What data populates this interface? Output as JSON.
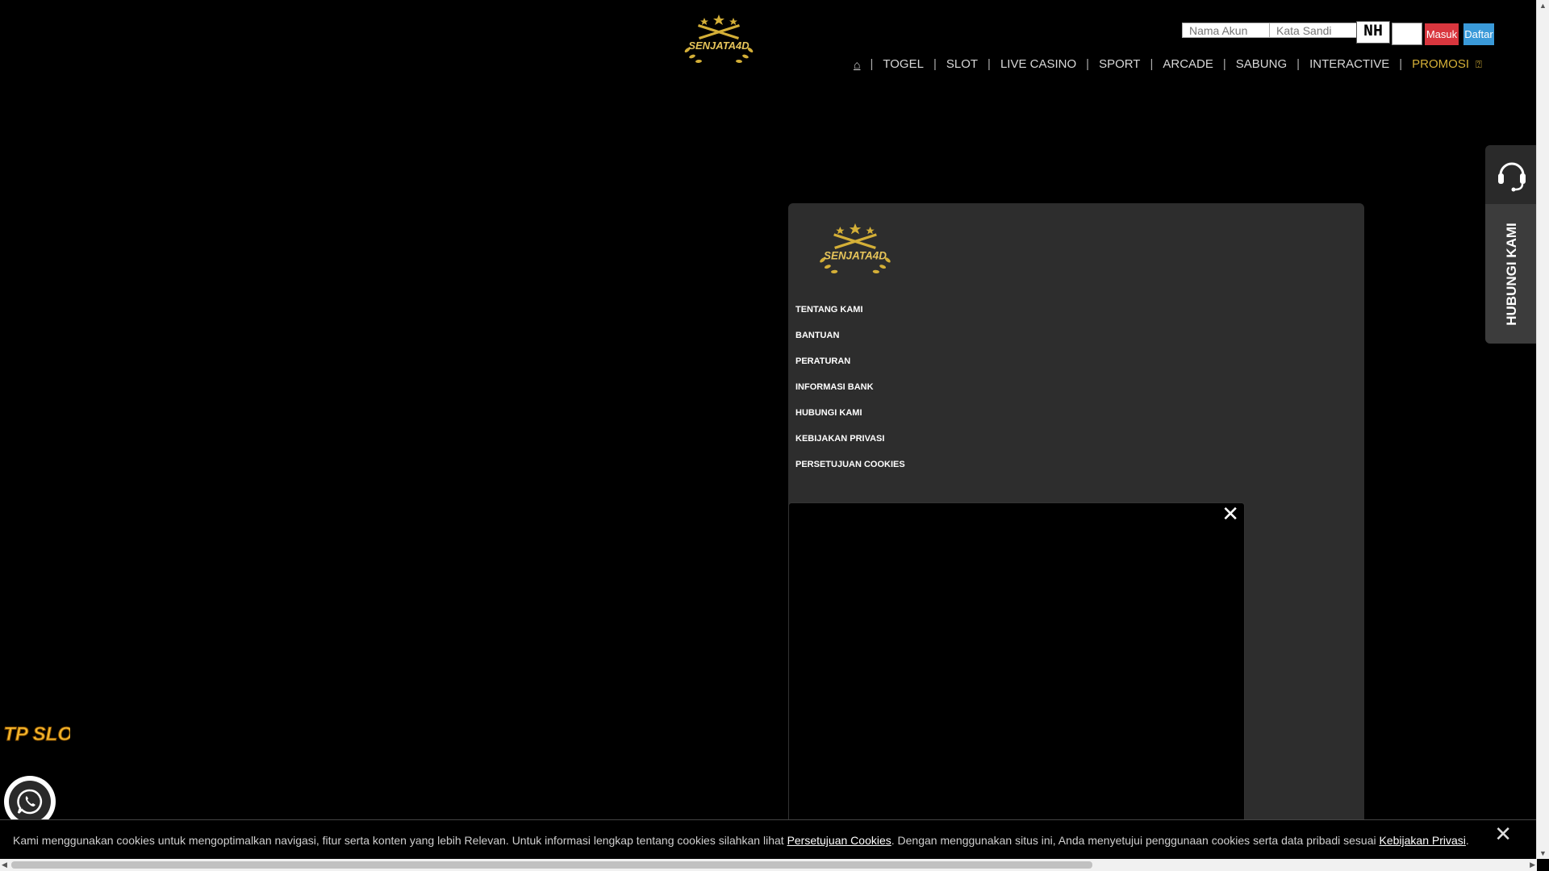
{
  "brand": {
    "logo_text": "SENJATA4D",
    "gold": "#d4af37"
  },
  "login": {
    "username_placeholder": "Nama Akun",
    "password_placeholder": "Kata Sandi",
    "captcha_text": "NH",
    "login_label": "Masuk",
    "register_label": "Daftar",
    "login_color": "#d9363e",
    "register_color": "#3a9ad9"
  },
  "nav": {
    "home_icon": "home-icon",
    "items": [
      "TOGEL",
      "SLOT",
      "LIVE CASINO",
      "SPORT",
      "ARCADE",
      "SABUNG",
      "INTERACTIVE"
    ],
    "promo_label": "PROMOSI"
  },
  "contact_widget": {
    "icon": "headset-icon",
    "label": "HUBUNGI KAMI"
  },
  "menu": {
    "items": [
      "TENTANG KAMI",
      "BANTUAN",
      "PERATURAN",
      "INFORMASI BANK",
      "HUBUNGI KAMI",
      "KEBIJAKAN PRIVASI",
      "PERSETUJUAN COOKIES"
    ]
  },
  "popup": {
    "close_icon": "close-icon"
  },
  "floating": {
    "rtp_label": "RTP SLOT",
    "whatsapp_icon": "whatsapp-icon"
  },
  "cookie": {
    "text_1": "Kami menggunakan cookies untuk mengoptimalkan navigasi, fitur serta konten yang lebih Relevan. Untuk informasi lengkap tentang cookies silahkan lihat ",
    "link_1": "Persetujuan Cookies",
    "text_2": ". Dengan menggunakan situs ini, Anda menyetujui penggunaan cookies serta data pribadi sesuai ",
    "link_2": "Kebijakan Privasi",
    "text_3": "."
  }
}
